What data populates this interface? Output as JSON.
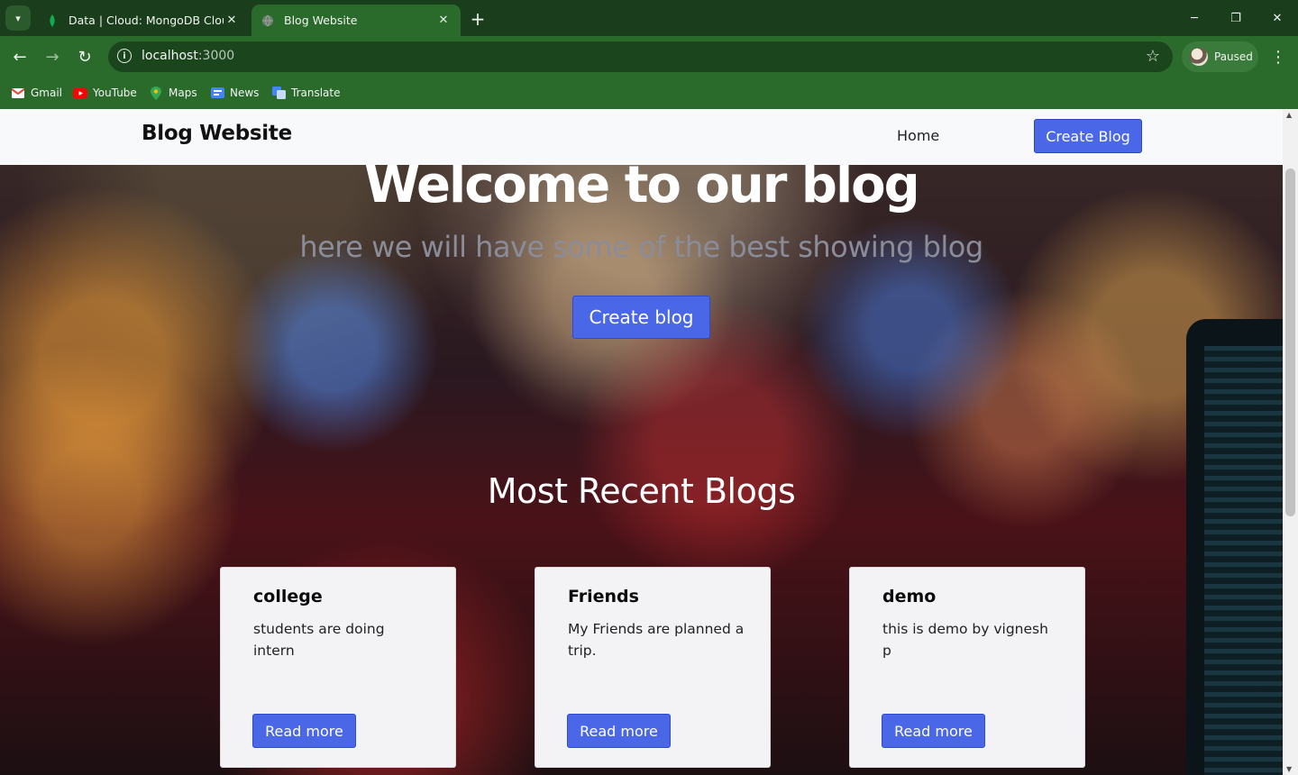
{
  "browser": {
    "tabs": [
      {
        "title": "Data | Cloud: MongoDB Cloud",
        "icon": "mongodb-leaf-icon",
        "active": false
      },
      {
        "title": "Blog Website",
        "icon": "globe-icon",
        "active": true
      }
    ],
    "new_tab_symbol": "+",
    "url_host": "localhost",
    "url_port": ":3000",
    "profile_status": "Paused",
    "bookmarks": [
      {
        "label": "Gmail",
        "icon": "gmail-icon"
      },
      {
        "label": "YouTube",
        "icon": "youtube-icon"
      },
      {
        "label": "Maps",
        "icon": "maps-icon"
      },
      {
        "label": "News",
        "icon": "news-icon"
      },
      {
        "label": "Translate",
        "icon": "translate-icon"
      }
    ]
  },
  "site": {
    "brand": "Blog Website",
    "nav": {
      "home": "Home",
      "create": "Create Blog"
    },
    "hero": {
      "title": "Welcome to our blog",
      "subtitle": "here we will have some of the best showing blog",
      "button": "Create blog"
    },
    "recent_title": "Most Recent Blogs",
    "posts": [
      {
        "title": "college",
        "body": "students are doing intern",
        "button": "Read more"
      },
      {
        "title": "Friends",
        "body": "My Friends are planned a trip.",
        "button": "Read more"
      },
      {
        "title": "demo",
        "body": "this is demo by vignesh p",
        "button": "Read more"
      }
    ]
  },
  "colors": {
    "browser_frame": "#2a6a2b",
    "accent_button": "#4a67e8",
    "nav_bg": "#f8f9fb",
    "card_bg": "#f3f3f5"
  }
}
